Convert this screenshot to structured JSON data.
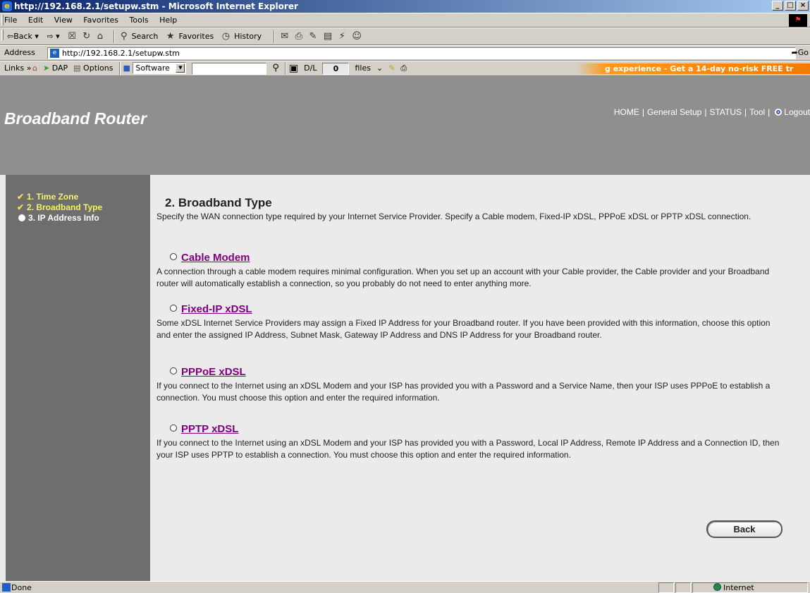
{
  "window": {
    "title": "http://192.168.2.1/setupw.stm - Microsoft Internet Explorer",
    "controls": [
      "_",
      "□",
      "×"
    ]
  },
  "menu": [
    "File",
    "Edit",
    "View",
    "Favorites",
    "Tools",
    "Help"
  ],
  "toolbar": {
    "back": "⇦Back ▾",
    "forward": "⇨ ▾",
    "search": "Search",
    "favorites": "Favorites",
    "history": "History"
  },
  "address": {
    "label": "Address",
    "url": "http://192.168.2.1/setupw.stm",
    "go": "Go"
  },
  "links_bar": {
    "label": "Links »",
    "dap": "DAP",
    "options": "Options",
    "software": "Software",
    "dl_label": "D/L",
    "dl_count": "0",
    "files": "files",
    "ad": "g experience - Get a 14-day no-risk FREE tr"
  },
  "router": {
    "brand": "Broadband Router",
    "nav": [
      "HOME",
      "General Setup",
      "STATUS",
      "Tool",
      "Logout"
    ],
    "steps": [
      {
        "label": "1. Time Zone",
        "state": "done"
      },
      {
        "label": "2. Broadband Type",
        "state": "done"
      },
      {
        "label": "3. IP Address Info",
        "state": "current"
      }
    ],
    "heading": "2. Broadband Type",
    "intro": "Specify the WAN connection type required by your Internet Service Provider. Specify a Cable modem, Fixed-IP xDSL, PPPoE xDSL or PPTP xDSL connection.",
    "options": [
      {
        "title": "Cable Modem",
        "desc": "A connection through a cable modem requires minimal configuration. When you set up an account with your Cable provider, the Cable provider and your Broadband router will automatically establish a connection, so you probably do not need to enter anything more."
      },
      {
        "title": "Fixed-IP xDSL",
        "desc": "Some xDSL Internet Service Providers may assign a Fixed IP Address for your Broadband router. If you have been provided with this information, choose this option and enter the assigned IP Address, Subnet Mask, Gateway IP Address and DNS IP Address for your Broadband router."
      },
      {
        "title": "PPPoE xDSL",
        "desc": "If you connect to the Internet using an xDSL Modem and your ISP has provided you with a Password and a Service Name, then your ISP uses PPPoE to establish a connection. You must choose this option and enter the required information."
      },
      {
        "title": "PPTP xDSL",
        "desc": "If you connect to the Internet using an xDSL Modem and your ISP has provided you with a Password, Local IP Address, Remote IP Address and a Connection ID, then your ISP uses PPTP to establish a connection. You must choose this option and enter the required information."
      }
    ],
    "back": "Back"
  },
  "status": {
    "text": "Done",
    "zone": "Internet"
  }
}
